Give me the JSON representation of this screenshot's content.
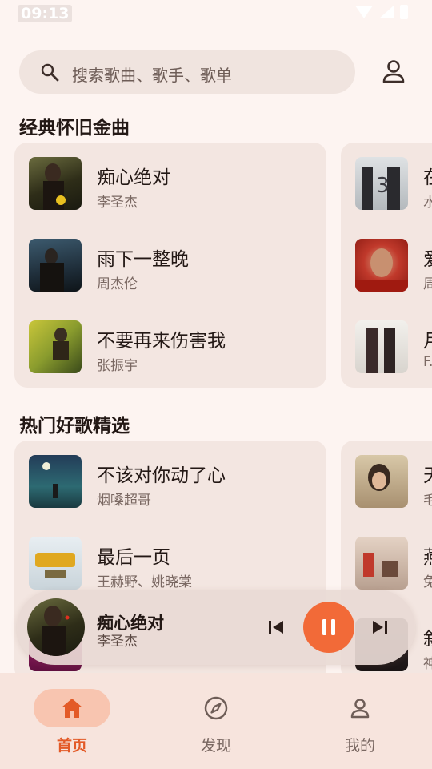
{
  "status": {
    "time": "09:13"
  },
  "search": {
    "placeholder": "搜索歌曲、歌手、歌单"
  },
  "sections": [
    {
      "title": "经典怀旧金曲",
      "left_card": [
        {
          "title": "痴心绝对",
          "artist": "李圣杰"
        },
        {
          "title": "雨下一整晚",
          "artist": "周杰伦"
        },
        {
          "title": "不要再来伤害我",
          "artist": "张振宇"
        }
      ],
      "right_card": [
        {
          "title": "在",
          "artist": "水"
        },
        {
          "title": "爱",
          "artist": "周"
        },
        {
          "title": "月",
          "artist": "F."
        }
      ]
    },
    {
      "title": "热门好歌精选",
      "left_card": [
        {
          "title": "不该对你动了心",
          "artist": "烟嗓超哥"
        },
        {
          "title": "最后一页",
          "artist": "王赫野、姚晓棠"
        },
        {
          "title": "",
          "artist": ""
        }
      ],
      "right_card": [
        {
          "title": "天",
          "artist": "毛"
        },
        {
          "title": "燕",
          "artist": "兔"
        },
        {
          "title": "叙",
          "artist": "神"
        }
      ]
    }
  ],
  "player": {
    "title": "痴心绝对",
    "artist": "李圣杰",
    "state": "playing"
  },
  "nav": [
    {
      "label": "首页",
      "icon": "home-icon",
      "active": true
    },
    {
      "label": "发现",
      "icon": "compass-icon",
      "active": false
    },
    {
      "label": "我的",
      "icon": "person-icon",
      "active": false
    }
  ],
  "colors": {
    "accent": "#f26a38",
    "background": "#fdf4f1",
    "card": "#f3e6e1"
  }
}
